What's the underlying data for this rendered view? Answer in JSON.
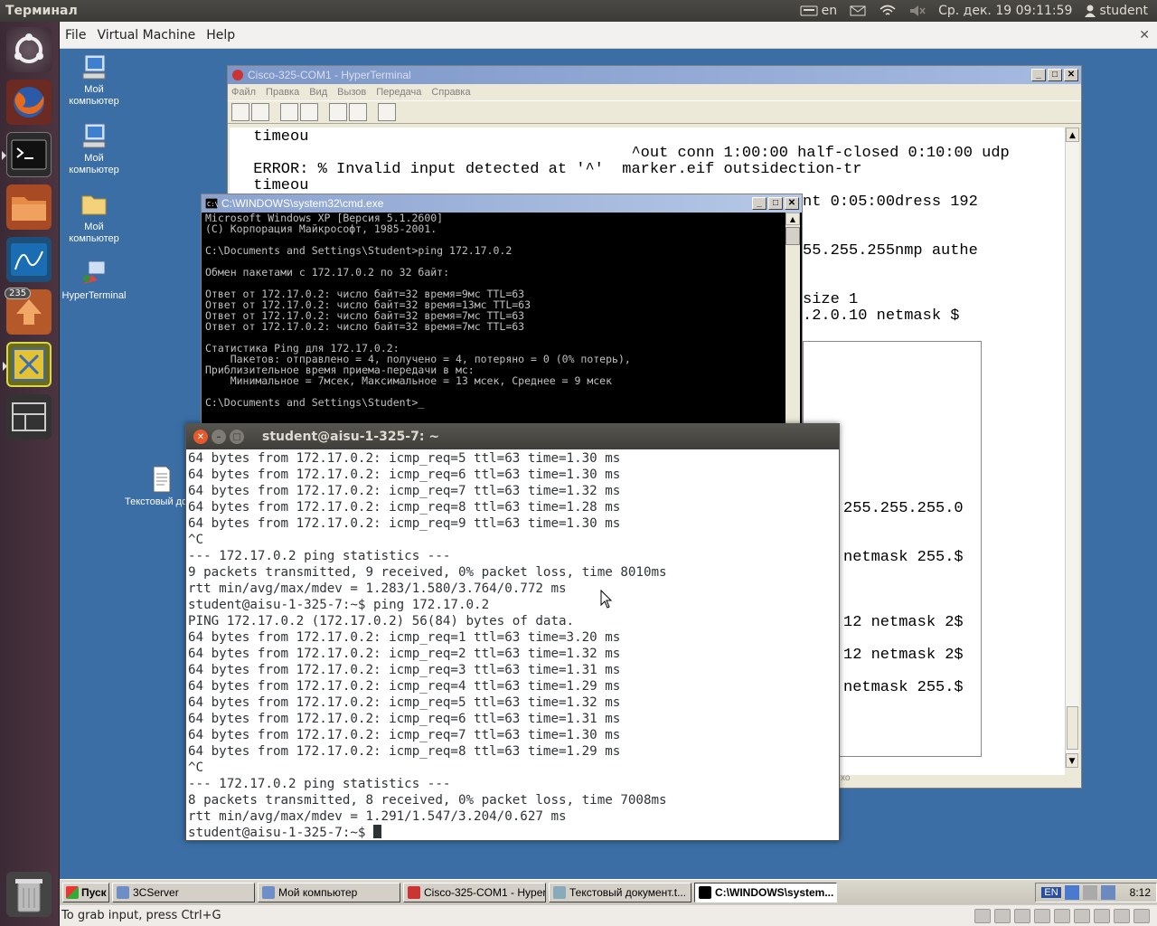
{
  "topbar": {
    "app_title": "Терминал",
    "keyboard_layout": "en",
    "datetime": "Ср. дек. 19 09:11:59",
    "username": "student"
  },
  "launcher": {
    "items": [
      {
        "name": "dash-home",
        "icon": "ubuntu-logo-icon"
      },
      {
        "name": "firefox",
        "icon": "firefox-icon"
      },
      {
        "name": "terminal",
        "icon": "terminal-icon"
      },
      {
        "name": "file-manager",
        "icon": "folder-icon"
      },
      {
        "name": "wireshark",
        "icon": "wireshark-icon"
      },
      {
        "name": "update-manager",
        "icon": "update-icon",
        "badge": "235"
      },
      {
        "name": "virtualbox",
        "icon": "virtualbox-icon"
      },
      {
        "name": "workspace-switcher",
        "icon": "workspace-icon"
      },
      {
        "name": "trash",
        "icon": "trash-icon"
      }
    ]
  },
  "vbox_menu": {
    "file": "File",
    "machine": "Virtual Machine",
    "help": "Help"
  },
  "status": {
    "hint": "To grab input, press Ctrl+G"
  },
  "desktop": {
    "icons": [
      {
        "label": "Мой компьютер"
      },
      {
        "label": "Мой компьютер"
      },
      {
        "label": "Мой компьютер"
      },
      {
        "label": "HyperTerminal"
      },
      {
        "label": "Текстовый документ.txt"
      }
    ]
  },
  "hyperterminal": {
    "title": "Cisco-325-COM1 - HyperTerminal",
    "menu": [
      "Файл",
      "Правка",
      "Вид",
      "Вызов",
      "Передача",
      "Справка"
    ],
    "lines": [
      " timeou",
      "                                          ^out conn 1:00:00 half-closed 0:10:00 udp",
      " ERROR: % Invalid input detected at '^'  marker.eif outsidection-tr",
      " timeou"
    ],
    "right_frags": [
      "nt 0:05:00dress 192",
      "55.255.255nmp authe",
      "size 1",
      ".2.0.10 netmask $"
    ],
    "inner_frags": [
      "255.255.255.0",
      "netmask 255.$",
      "12 netmask 2$",
      "12 netmask 2$",
      "netmask 255.$"
    ],
    "status_frag": "хо"
  },
  "cmd": {
    "title": "C:\\WINDOWS\\system32\\cmd.exe",
    "lines": [
      "Microsoft Windows XP [Версия 5.1.2600]",
      "(С) Корпорация Майкрософт, 1985-2001.",
      "",
      "C:\\Documents and Settings\\Student>ping 172.17.0.2",
      "",
      "Обмен пакетами с 172.17.0.2 по 32 байт:",
      "",
      "Ответ от 172.17.0.2: число байт=32 время=9мс TTL=63",
      "Ответ от 172.17.0.2: число байт=32 время=13мс TTL=63",
      "Ответ от 172.17.0.2: число байт=32 время=7мс TTL=63",
      "Ответ от 172.17.0.2: число байт=32 время=7мс TTL=63",
      "",
      "Статистика Ping для 172.17.0.2:",
      "    Пакетов: отправлено = 4, получено = 4, потеряно = 0 (0% потерь),",
      "Приблизительное время приема-передачи в мс:",
      "    Минимальное = 7мсек, Максимальное = 13 мсек, Среднее = 9 мсек",
      "",
      "C:\\Documents and Settings\\Student>_"
    ]
  },
  "gterm": {
    "title": "student@aisu-1-325-7: ~",
    "lines": [
      "64 bytes from 172.17.0.2: icmp_req=5 ttl=63 time=1.30 ms",
      "64 bytes from 172.17.0.2: icmp_req=6 ttl=63 time=1.30 ms",
      "64 bytes from 172.17.0.2: icmp_req=7 ttl=63 time=1.32 ms",
      "64 bytes from 172.17.0.2: icmp_req=8 ttl=63 time=1.28 ms",
      "64 bytes from 172.17.0.2: icmp_req=9 ttl=63 time=1.30 ms",
      "^C",
      "--- 172.17.0.2 ping statistics ---",
      "9 packets transmitted, 9 received, 0% packet loss, time 8010ms",
      "rtt min/avg/max/mdev = 1.283/1.580/3.764/0.772 ms",
      "student@aisu-1-325-7:~$ ping 172.17.0.2",
      "PING 172.17.0.2 (172.17.0.2) 56(84) bytes of data.",
      "64 bytes from 172.17.0.2: icmp_req=1 ttl=63 time=3.20 ms",
      "64 bytes from 172.17.0.2: icmp_req=2 ttl=63 time=1.32 ms",
      "64 bytes from 172.17.0.2: icmp_req=3 ttl=63 time=1.31 ms",
      "64 bytes from 172.17.0.2: icmp_req=4 ttl=63 time=1.29 ms",
      "64 bytes from 172.17.0.2: icmp_req=5 ttl=63 time=1.32 ms",
      "64 bytes from 172.17.0.2: icmp_req=6 ttl=63 time=1.31 ms",
      "64 bytes from 172.17.0.2: icmp_req=7 ttl=63 time=1.30 ms",
      "64 bytes from 172.17.0.2: icmp_req=8 ttl=63 time=1.29 ms",
      "^C",
      "--- 172.17.0.2 ping statistics ---",
      "8 packets transmitted, 8 received, 0% packet loss, time 7008ms",
      "rtt min/avg/max/mdev = 1.291/1.547/3.204/0.627 ms"
    ],
    "prompt": "student@aisu-1-325-7:~$ "
  },
  "taskbar": {
    "start": "Пуск",
    "buttons": [
      {
        "label": "3CServer"
      },
      {
        "label": "Мой компьютер"
      },
      {
        "label": "Cisco-325-COM1 - Hyper..."
      },
      {
        "label": "Текстовый документ.t..."
      },
      {
        "label": "C:\\WINDOWS\\system..."
      }
    ],
    "lang": "EN",
    "clock": "8:12"
  }
}
